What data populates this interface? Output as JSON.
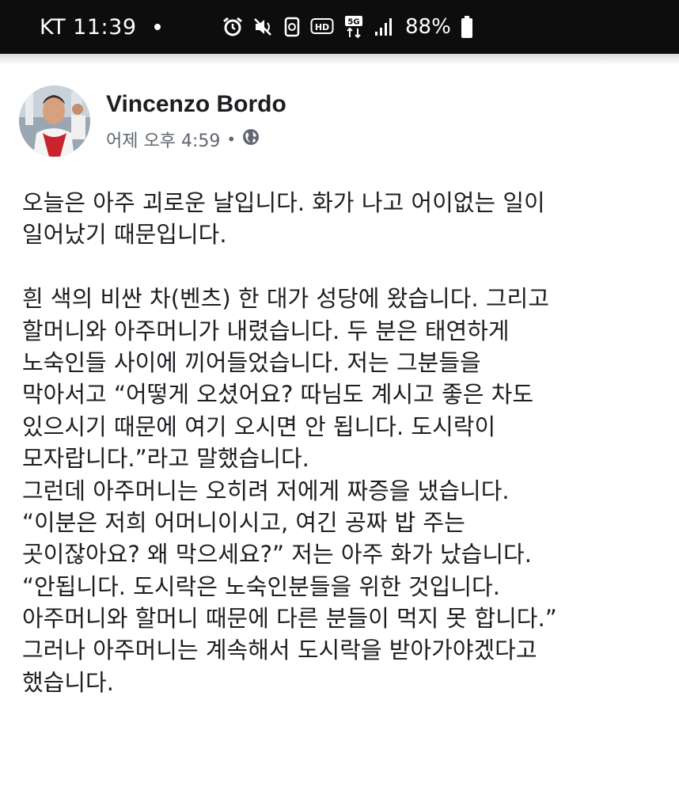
{
  "status_bar": {
    "carrier_time": "KT 11:39",
    "battery_percent": "88%",
    "network_label": "5G",
    "hd_label": "HD",
    "icons": [
      "alarm-icon",
      "mute-icon",
      "data-saver-icon",
      "hd-voice-icon",
      "5g-icon",
      "signal-icon",
      "battery-icon"
    ]
  },
  "post": {
    "author": "Vincenzo Bordo",
    "timestamp": "어제 오후 4:59",
    "separator": "•",
    "privacy_icon": "globe-icon",
    "body_lines": [
      "오늘은 아주 괴로운 날입니다. 화가 나고 어이없는 일이",
      "일어났기 때문입니다.",
      "",
      "흰 색의 비싼 차(벤츠) 한 대가 성당에 왔습니다. 그리고",
      "할머니와 아주머니가 내렸습니다. 두 분은 태연하게",
      "노숙인들 사이에 끼어들었습니다. 저는 그분들을",
      "막아서고 “어떻게 오셨어요? 따님도 계시고 좋은 차도",
      "있으시기 때문에 여기 오시면 안 됩니다. 도시락이",
      "모자랍니다.”라고 말했습니다.",
      "그런데 아주머니는 오히려 저에게 짜증을 냈습니다.",
      "“이분은 저희 어머니이시고, 여긴 공짜 밥 주는",
      "곳이잖아요? 왜 막으세요?” 저는 아주 화가 났습니다.",
      "“안됩니다. 도시락은 노숙인분들을 위한 것입니다.",
      "아주머니와 할머니 때문에 다른 분들이 먹지 못 합니다.”",
      "그러나 아주머니는 계속해서 도시락을 받아가야겠다고",
      "했습니다."
    ]
  },
  "colors": {
    "status_bar_bg": "#0d0d0d",
    "text_primary": "#1c1e21",
    "text_secondary": "#606770"
  }
}
